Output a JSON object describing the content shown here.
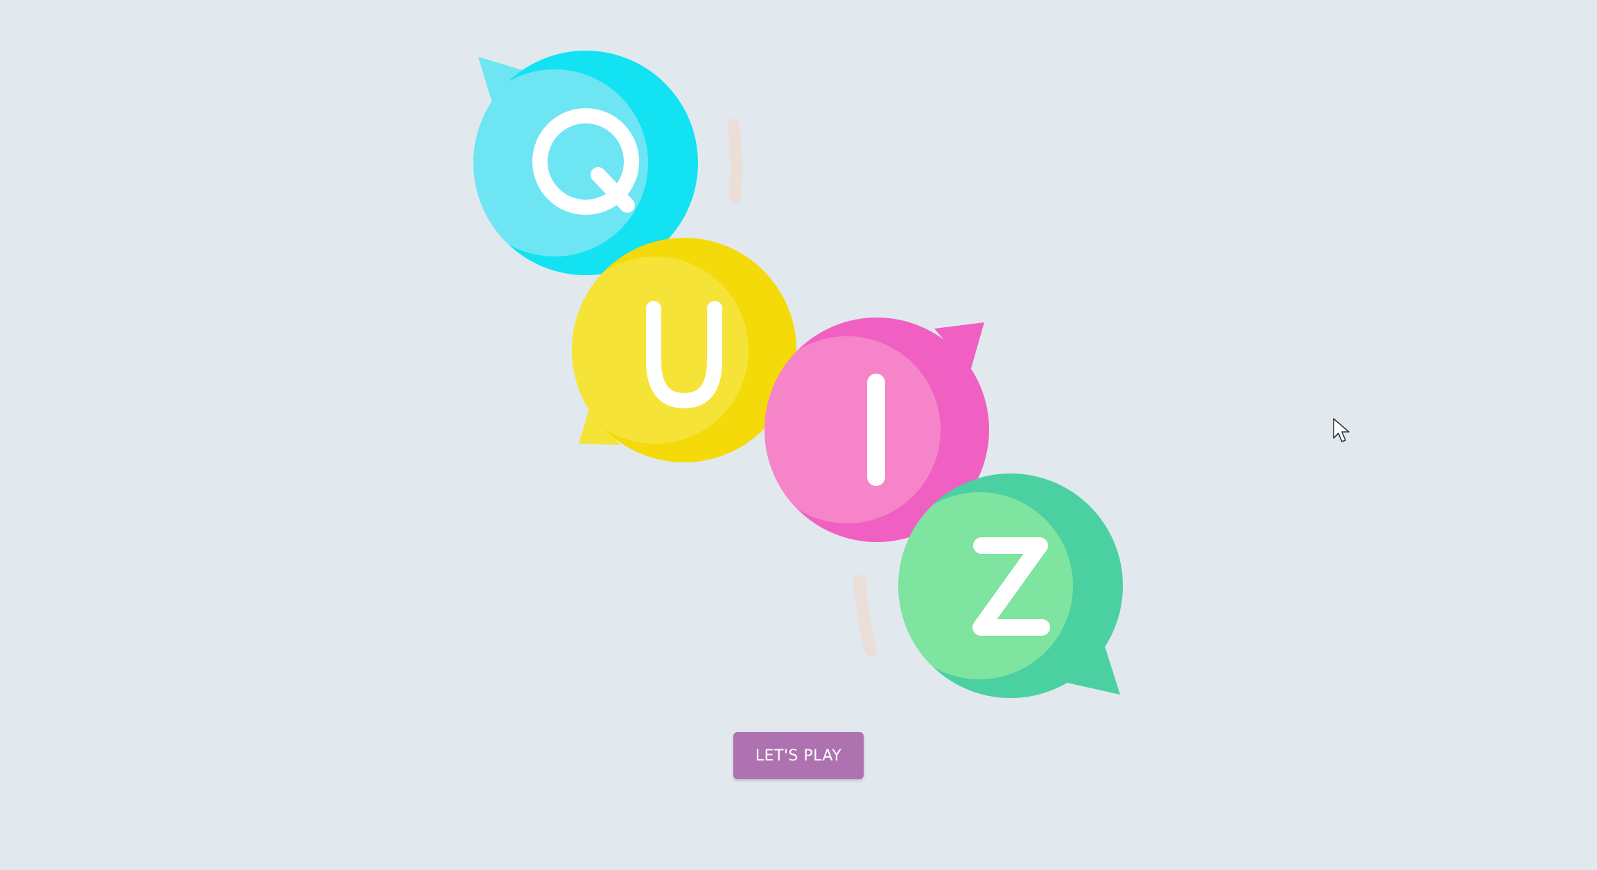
{
  "logo": {
    "letters": [
      "Q",
      "U",
      "I",
      "Z"
    ],
    "colors": {
      "q_light": "#6ee5f3",
      "q_dark": "#12e2f2",
      "u_light": "#f6e337",
      "u_dark": "#f4da09",
      "i_light": "#f584c9",
      "i_dark": "#f060c2",
      "z_light": "#7ee4a0",
      "z_dark": "#4ad0a1"
    }
  },
  "play_button": {
    "label": "LET'S PLAY",
    "color": "#ae72b0"
  },
  "background_color": "#e1e9ef"
}
